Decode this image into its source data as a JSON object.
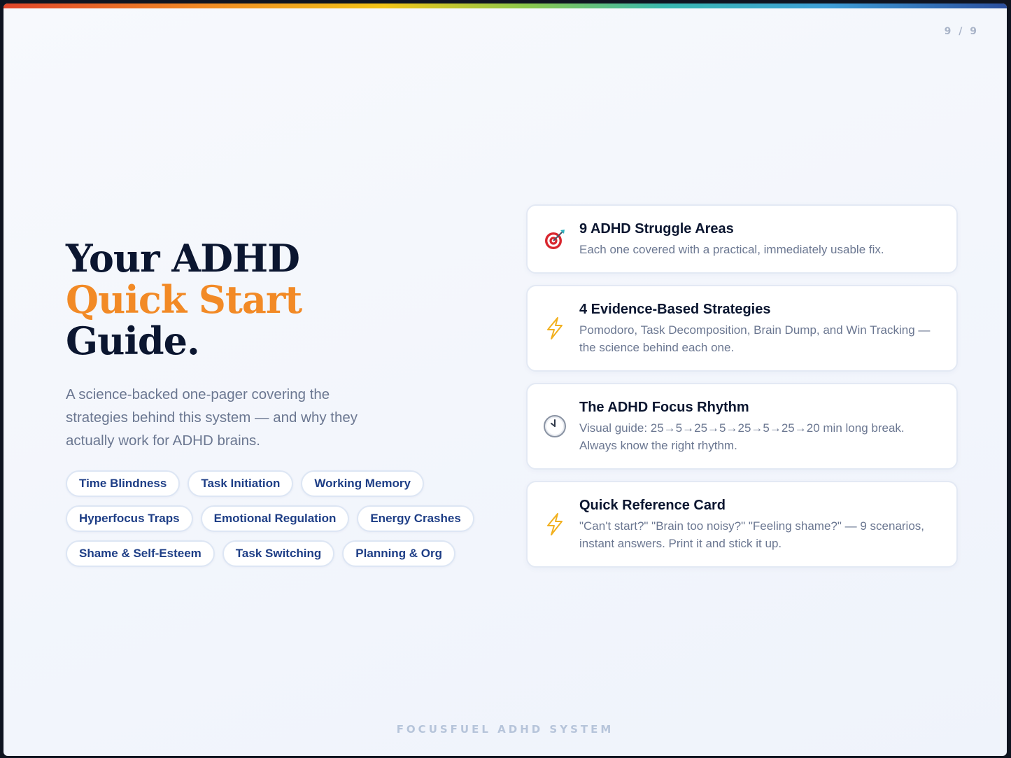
{
  "page_indicator": "9 / 9",
  "hero": {
    "title_line1": "Your ADHD",
    "title_line2": "Quick Start",
    "title_line3": "Guide.",
    "subtitle": "A science-backed one-pager covering the strategies behind this system — and why they actually work for ADHD brains."
  },
  "tags": [
    "Time Blindness",
    "Task Initiation",
    "Working Memory",
    "Hyperfocus Traps",
    "Emotional Regulation",
    "Energy Crashes",
    "Shame & Self-Esteem",
    "Task Switching",
    "Planning & Org"
  ],
  "cards": [
    {
      "icon": "target-icon",
      "title": "9 ADHD Struggle Areas",
      "text": "Each one covered with a practical, immediately usable fix."
    },
    {
      "icon": "lightning-icon",
      "title": "4 Evidence-Based Strategies",
      "text": "Pomodoro, Task Decomposition, Brain Dump, and Win Tracking — the science behind each one."
    },
    {
      "icon": "clock-icon",
      "title": "The ADHD Focus Rhythm",
      "text": "Visual guide: 25→5→25→5→25→5→25→20 min long break. Always know the right rhythm."
    },
    {
      "icon": "lightning-icon",
      "title": "Quick Reference Card",
      "text": "\"Can't start?\" \"Brain too noisy?\" \"Feeling shame?\" — 9 scenarios, instant answers. Print it and stick it up."
    }
  ],
  "footer": "FOCUSFUEL ADHD SYSTEM",
  "colors": {
    "accent": "#f28a26",
    "heading": "#0b1630",
    "tag_text": "#1e3e86"
  }
}
